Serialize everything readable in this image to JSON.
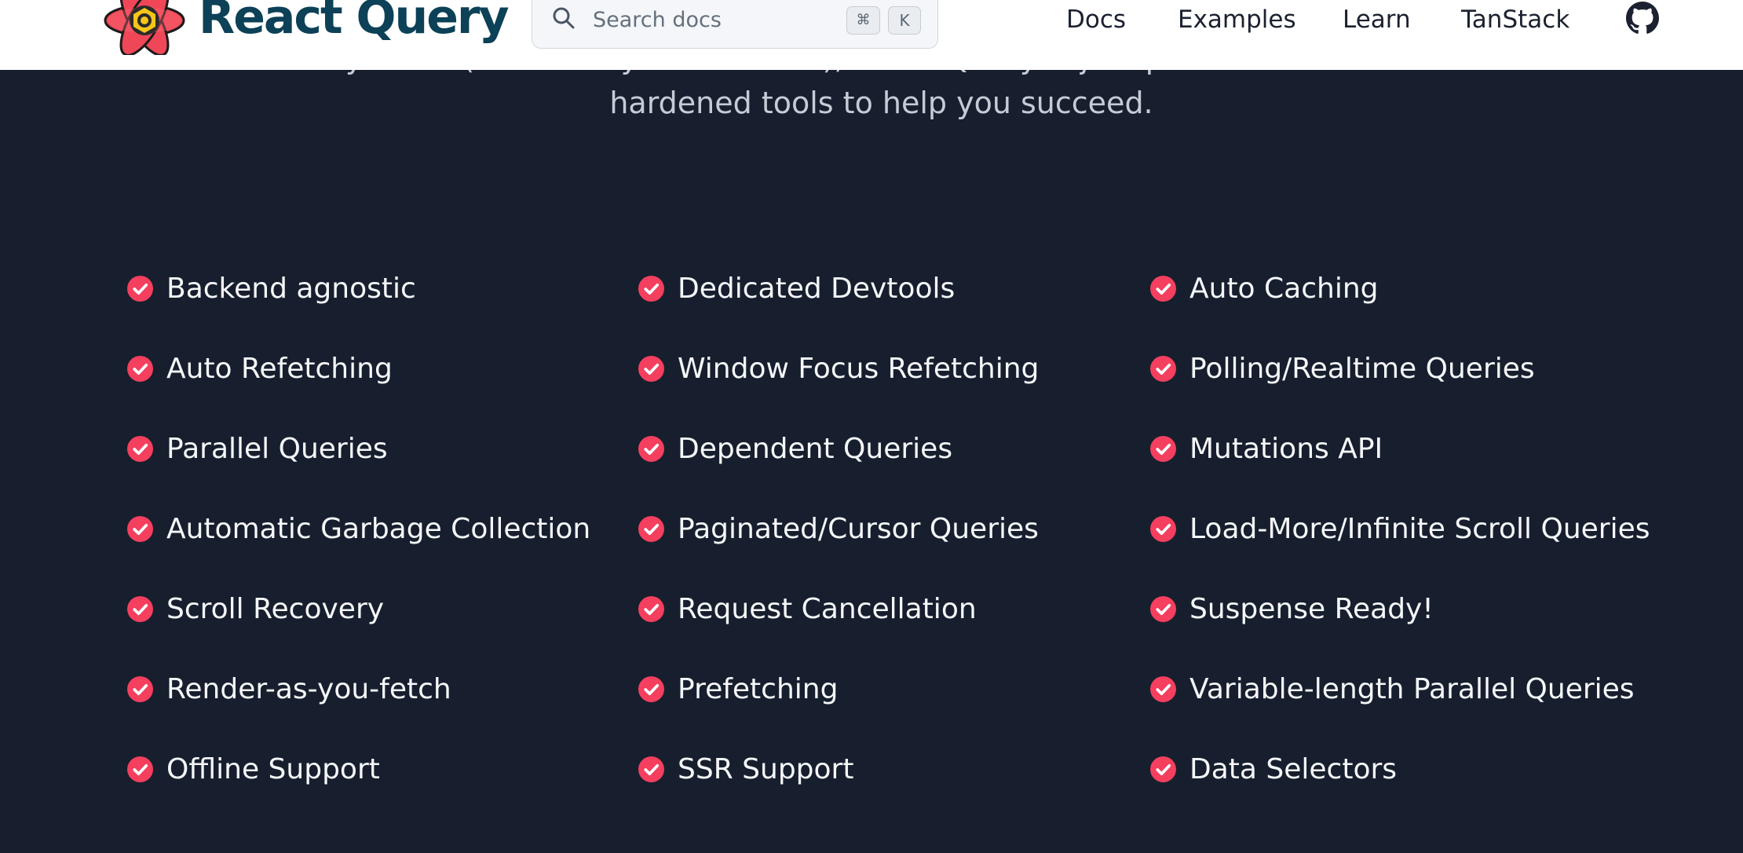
{
  "header": {
    "brand": "React Query",
    "search": {
      "placeholder": "Search docs",
      "shortcut_keys": [
        "⌘",
        "K"
      ]
    },
    "nav": {
      "docs": "Docs",
      "examples": "Examples",
      "learn": "Learn",
      "tanstack": "TanStack"
    },
    "icons": {
      "logo": "react-atom-logo-icon",
      "search": "search-icon",
      "github": "github-icon"
    }
  },
  "intro": {
    "line1": "systems (lookin' at you Walmart!), React Query is jam packed with battle-",
    "line2": "hardened tools to help you succeed."
  },
  "features": {
    "columns": [
      [
        "Backend agnostic",
        "Auto Refetching",
        "Parallel Queries",
        "Automatic Garbage Collection",
        "Scroll Recovery",
        "Render-as-you-fetch",
        "Offline Support"
      ],
      [
        "Dedicated Devtools",
        "Window Focus Refetching",
        "Dependent Queries",
        "Paginated/Cursor Queries",
        "Request Cancellation",
        "Prefetching",
        "SSR Support"
      ],
      [
        "Auto Caching",
        "Polling/Realtime Queries",
        "Mutations API",
        "Load-More/Infinite Scroll Queries",
        "Suspense Ready!",
        "Variable-length Parallel Queries",
        "Data Selectors"
      ]
    ],
    "icon": "check-circle-icon"
  },
  "colors": {
    "background": "#171f2e",
    "accent": "#f43f5e",
    "brand_text": "#0c4157",
    "header_bg": "#ffffff"
  }
}
